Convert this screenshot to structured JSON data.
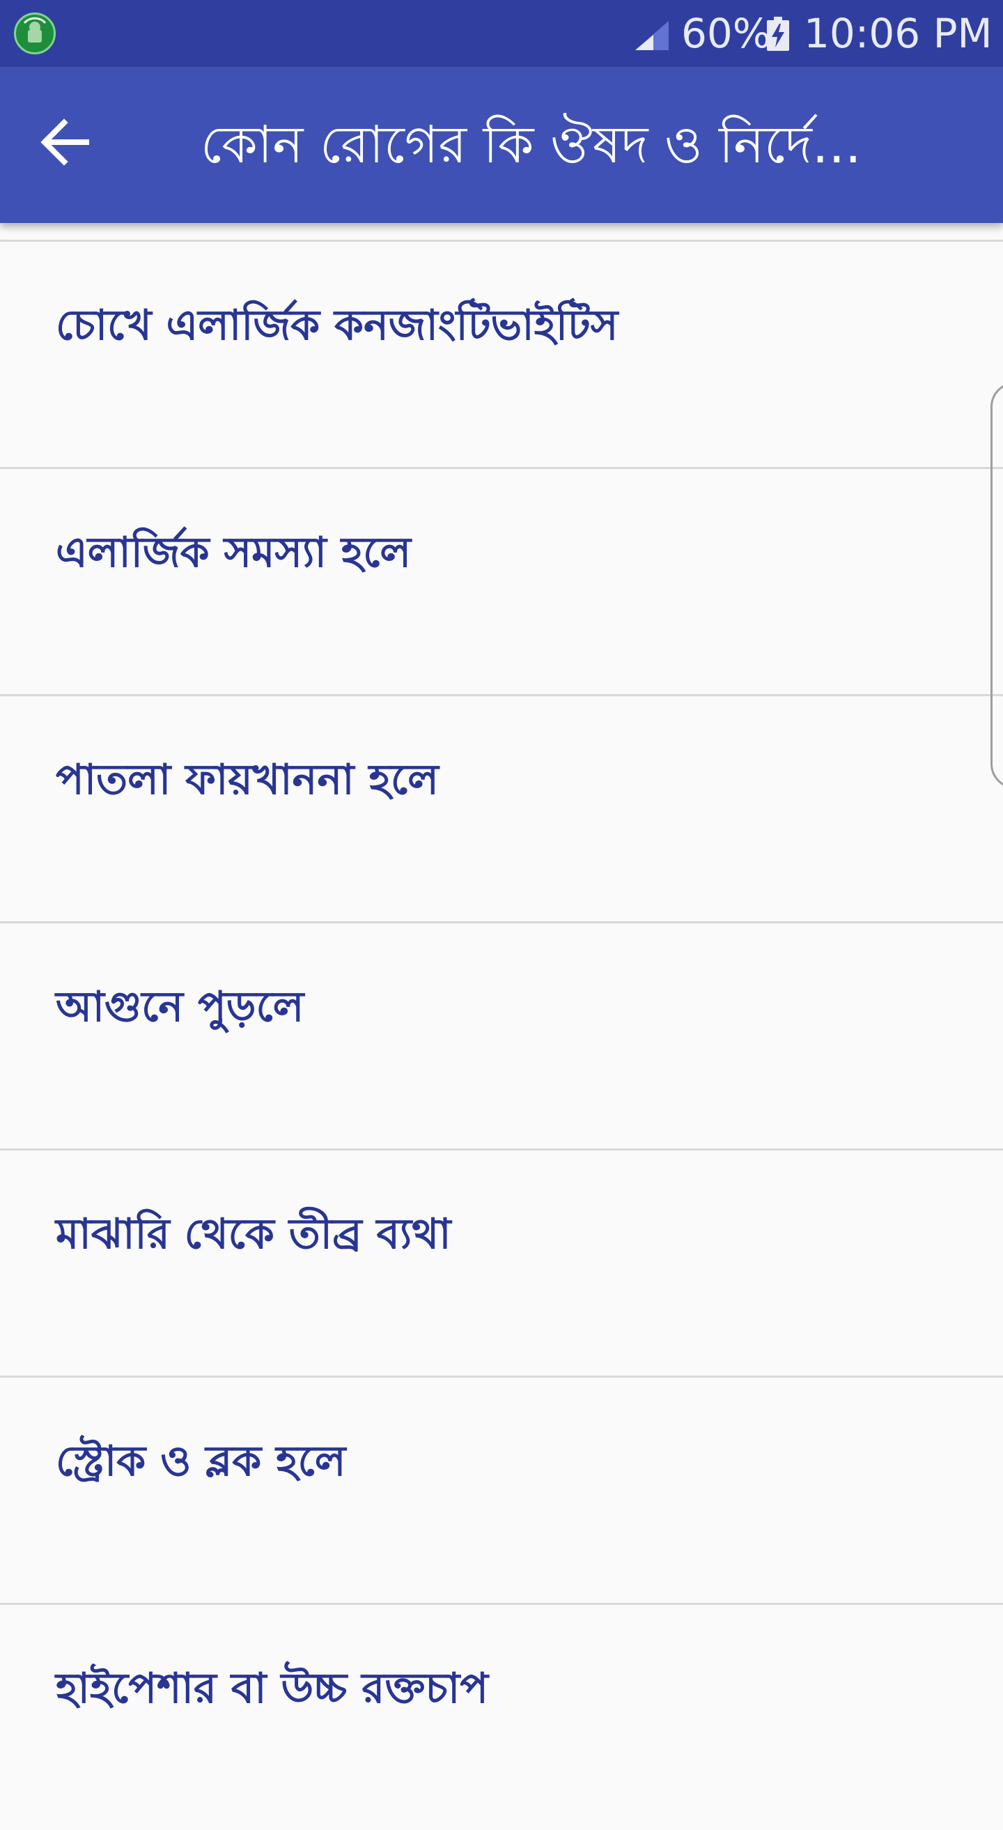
{
  "status_bar": {
    "battery_percent": "60%",
    "time": "10:06 PM",
    "icons": [
      "app-notification-icon",
      "signal-icon",
      "battery-charging-icon"
    ],
    "background_color": "#303f9f"
  },
  "app_bar": {
    "title": "কোন রোগের কি ঔষদ ও নির্দে...",
    "back_icon": "arrow-back-icon",
    "background_color": "#3f51b5"
  },
  "list": {
    "text_color": "#283593",
    "items": [
      {
        "label": "চোখে এলার্জিক কনজাংটিভাইটিস"
      },
      {
        "label": "এলার্জিক সমস্যা হলে"
      },
      {
        "label": "পাতলা ফায়খাননা হলে"
      },
      {
        "label": "আগুনে পুড়লে"
      },
      {
        "label": "মাঝারি থেকে তীব্র ব্যথা"
      },
      {
        "label": "স্ট্রোক ও ব্লক হলে"
      },
      {
        "label": "হাইপেশার বা উচ্চ রক্তচাপ"
      }
    ]
  }
}
